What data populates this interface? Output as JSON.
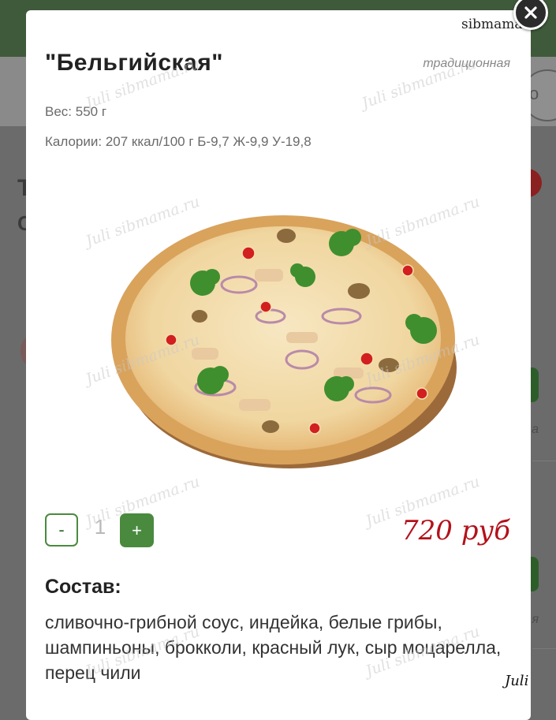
{
  "product": {
    "title": "\"Бельгийская\"",
    "subtitle": "традиционная",
    "weight": "Вес: 550 г",
    "calories": "Калории: 207 ккал/100 г Б-9,7 Ж-9,9 У-19,8",
    "price": "720 руб"
  },
  "quantity": {
    "minus_label": "-",
    "value": "1",
    "plus_label": "+"
  },
  "composition": {
    "heading": "Состав:",
    "text": "сливочно-грибной соус, индейка, белые грибы, шампиньоны, брокколи, красный лук, сыр моцарелла, перец чили"
  },
  "watermarks": {
    "site": "sibmama.ru",
    "diagonal": "Juli sibmama.ru",
    "signature": "Juli"
  },
  "icons": {
    "close": "close-icon"
  },
  "colors": {
    "accent_green": "#4a8a3f",
    "price_red": "#b3111a"
  }
}
